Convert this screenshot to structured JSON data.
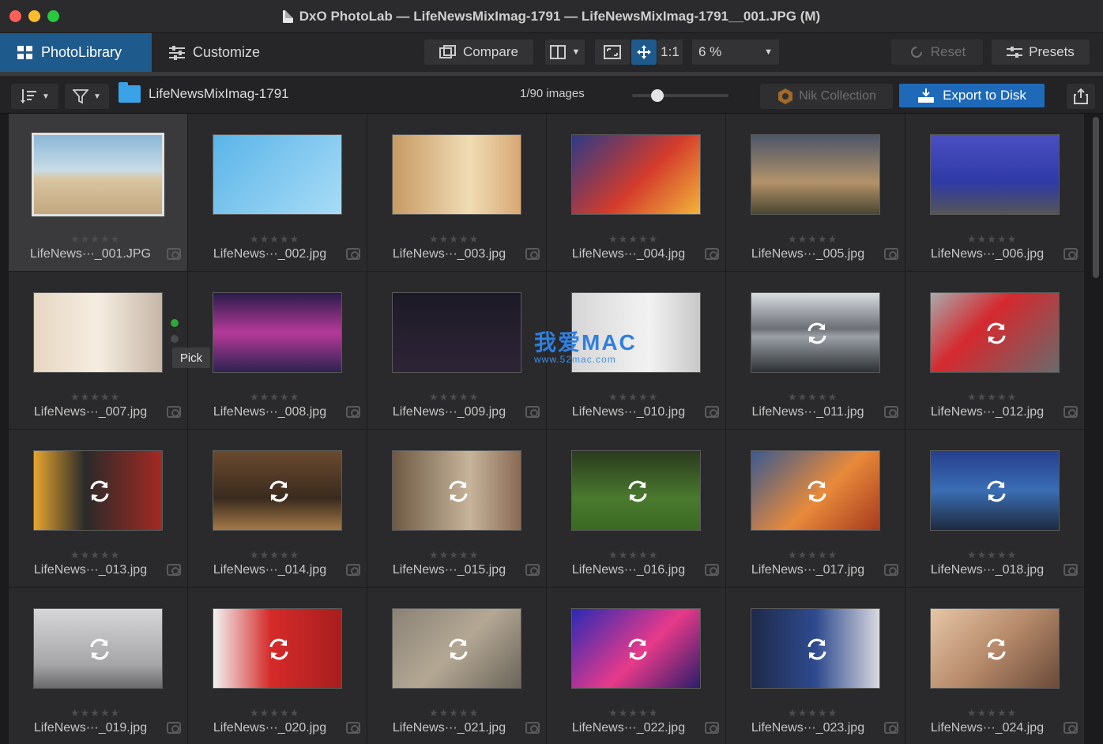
{
  "window": {
    "title": "DxO PhotoLab — LifeNewsMixImag-1791 — LifeNewsMixImag-1791__001.JPG (M)"
  },
  "toolbar": {
    "tab_library": "PhotoLibrary",
    "tab_customize": "Customize",
    "compare": "Compare",
    "one_to_one": "1:1",
    "zoom": "6 %",
    "reset": "Reset",
    "presets": "Presets"
  },
  "browser": {
    "folder": "LifeNewsMixImag-1791",
    "count": "1/90 images",
    "slider_value": 0.2,
    "nik": "Nik Collection",
    "export": "Export to Disk"
  },
  "tooltip": {
    "pick": "Pick"
  },
  "watermark": {
    "main": "我爱MAC",
    "sub": "www.52mac.com"
  },
  "stars": "★★★★★",
  "thumbs": [
    {
      "name": "LifeNews···_001.JPG",
      "bg": "linear-gradient(#8ab8d8 0%, #c9dce6 45%, #d8c6a2 55%, #c3a77e 100%)",
      "refresh": false
    },
    {
      "name": "LifeNews···_002.jpg",
      "bg": "linear-gradient(135deg, #5ab4e8, #a8dcf6)",
      "refresh": false
    },
    {
      "name": "LifeNews···_003.jpg",
      "bg": "linear-gradient(90deg, #c79a64, #f0dcb4 60%, #d7a874)",
      "refresh": false
    },
    {
      "name": "LifeNews···_004.jpg",
      "bg": "linear-gradient(135deg, #2c3a86, #d43c2c 55%, #f2b43a)",
      "refresh": false
    },
    {
      "name": "LifeNews···_005.jpg",
      "bg": "linear-gradient(#4c5668, #b2926a 60%, #4a4630)",
      "refresh": false
    },
    {
      "name": "LifeNews···_006.jpg",
      "bg": "linear-gradient(#4a4ec2, #2f3aa6 60%, #555)",
      "refresh": false
    },
    {
      "name": "LifeNews···_007.jpg",
      "bg": "linear-gradient(90deg, #e6d6c2, #f6ede2 50%, #c6b6a6)",
      "refresh": false
    },
    {
      "name": "LifeNews···_008.jpg",
      "bg": "linear-gradient(#2a1c4a, #b63a9a 50%, #2d2250)",
      "refresh": false
    },
    {
      "name": "LifeNews···_009.jpg",
      "bg": "linear-gradient(#1c1a26, #2e2436)",
      "refresh": false
    },
    {
      "name": "LifeNews···_010.jpg",
      "bg": "linear-gradient(90deg, #d6d6d6, #f2f2f2 60%, #c8c8c8)",
      "refresh": false
    },
    {
      "name": "LifeNews···_011.jpg",
      "bg": "linear-gradient(#d8dde2, #6c7076 45%, #9aa0a6 55%, #2e3236)",
      "refresh": true
    },
    {
      "name": "LifeNews···_012.jpg",
      "bg": "linear-gradient(135deg, #a9a9ab, #d4292e 40%, #6a6a6c)",
      "refresh": true
    },
    {
      "name": "LifeNews···_013.jpg",
      "bg": "linear-gradient(90deg, #e6a52e, #2a2a2a 40%, #a32a22)",
      "refresh": true
    },
    {
      "name": "LifeNews···_014.jpg",
      "bg": "linear-gradient(#6a4a2e, #3a2a1e 60%, #a47a48)",
      "refresh": true
    },
    {
      "name": "LifeNews···_015.jpg",
      "bg": "linear-gradient(90deg, #6e5a44, #c6b49a 60%, #8a6a54)",
      "refresh": true
    },
    {
      "name": "LifeNews···_016.jpg",
      "bg": "linear-gradient(#2a3a1e, #4a7a2e 60%, #3a6a22)",
      "refresh": true
    },
    {
      "name": "LifeNews···_017.jpg",
      "bg": "linear-gradient(135deg, #3a5a8e, #e88a3a 55%, #a63a1e)",
      "refresh": true
    },
    {
      "name": "LifeNews···_018.jpg",
      "bg": "linear-gradient(#263e8e, #3a6eb4 50%, #1e2a3e)",
      "refresh": true
    },
    {
      "name": "LifeNews···_019.jpg",
      "bg": "linear-gradient(#d6d6d8, #a6a6a8 70%, #6a6a6c)",
      "refresh": true
    },
    {
      "name": "LifeNews···_020.jpg",
      "bg": "linear-gradient(90deg, #f2f2f2, #d62a2a 45%, #a81e1e)",
      "refresh": true
    },
    {
      "name": "LifeNews···_021.jpg",
      "bg": "linear-gradient(135deg, #8a8276, #b4a894 50%, #6a645a)",
      "refresh": true
    },
    {
      "name": "LifeNews···_022.jpg",
      "bg": "linear-gradient(135deg, #2a2ab4, #e83a8a 55%, #2a1e6a)",
      "refresh": true
    },
    {
      "name": "LifeNews···_023.jpg",
      "bg": "linear-gradient(90deg, #1e2a4a, #2e4a8e 50%, #d8d8e0)",
      "refresh": true
    },
    {
      "name": "LifeNews···_024.jpg",
      "bg": "linear-gradient(135deg, #e6c6a6, #b68a6a 50%, #6a4a3a)",
      "refresh": true
    }
  ]
}
